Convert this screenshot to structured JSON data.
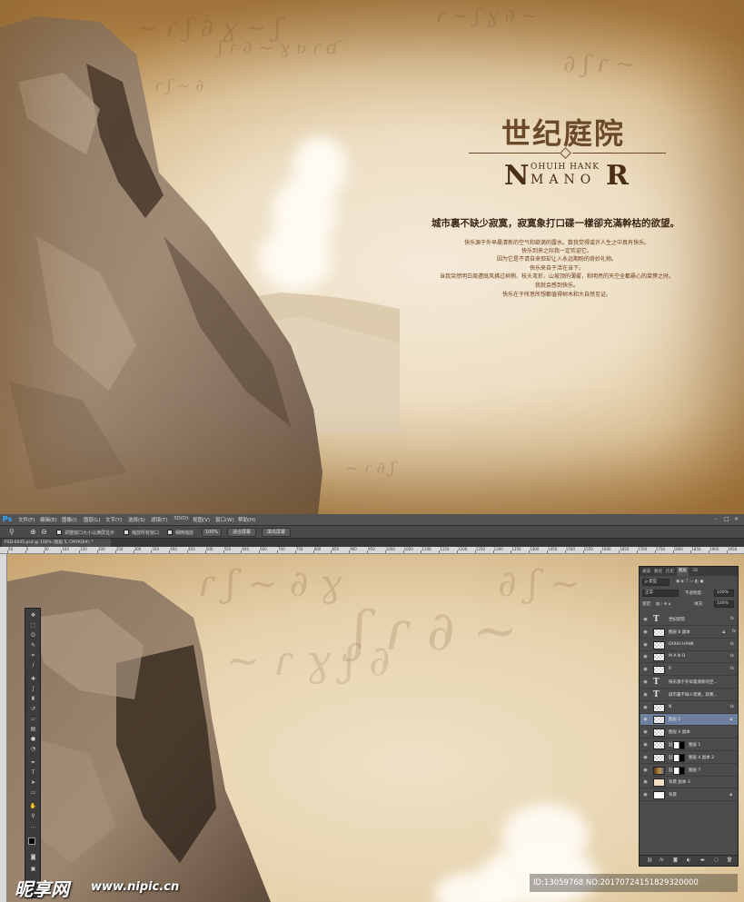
{
  "artwork": {
    "title_cn": "世纪庭院",
    "title_en_small": "OHUIH HANK",
    "title_en_left": "N",
    "title_en_mid": "MANO",
    "title_en_right": "R",
    "poem_title": "城市裏不缺少寂寞，寂寞象打口碟一樣卻充滿幹枯的欲望。",
    "poem_lines": [
      "快乐源于外早晨清新的空气和欲滴的露水。数我觉得或许人生之中真有快乐。",
      "快乐到来之际我一定欢迎它。",
      "因为它是不请自来但却让人永远期盼的奇妙礼物。",
      "快乐来自于活在当下。",
      "当我突然明白周遭既风拂过树梢、枝头弯折、山坡顶的薄雾，和明亮的天空全都悬心的菜悸之时。",
      "我就会感到快乐。",
      "快乐在于所思所想都值得树木和大自然见证。"
    ]
  },
  "ps": {
    "logo": "Ps",
    "menu": [
      "文件(F)",
      "编辑(E)",
      "图像(I)",
      "图层(L)",
      "文字(Y)",
      "选择(S)",
      "滤镜(T)",
      "3D(D)",
      "视图(V)",
      "窗口(W)",
      "帮助(H)"
    ],
    "window_controls": [
      "–",
      "□",
      "×"
    ],
    "options": {
      "resize_label": "调整窗口大小以满屏显示",
      "zoom_all_label": "缩放所有窗口",
      "scrubby_label": "细微缩放",
      "btn_100": "100%",
      "btn_fit": "适合屏幕",
      "btn_fill": "填充屏幕"
    },
    "doc_tab": "PSD-0045.psd @ 100% (图层 5, CMYK/8#) *",
    "ruler_numbers": [
      "50",
      "0",
      "50",
      "100",
      "150",
      "200",
      "250",
      "300",
      "350",
      "400",
      "450",
      "500",
      "550",
      "600",
      "650",
      "700",
      "750",
      "800",
      "850",
      "900",
      "950",
      "1000",
      "1050",
      "1100",
      "1150",
      "1200",
      "1250",
      "1300",
      "1350",
      "1400",
      "1450",
      "1500",
      "1550",
      "1600",
      "1650",
      "1700",
      "1750",
      "1800",
      "1850",
      "1900",
      "1950"
    ],
    "tool_icons": [
      "move-icon",
      "marquee-icon",
      "lasso-icon",
      "quick-select-icon",
      "crop-icon",
      "eyedropper-icon",
      "heal-icon",
      "brush-icon",
      "stamp-icon",
      "history-brush-icon",
      "eraser-icon",
      "gradient-icon",
      "blur-icon",
      "dodge-icon",
      "pen-icon",
      "type-icon",
      "path-select-icon",
      "shape-icon",
      "hand-icon",
      "zoom-icon"
    ],
    "colors": {
      "foreground": "#000000",
      "background": "#ffffff",
      "selected_layer": "#6e7fa0"
    },
    "layers_panel": {
      "tabs": [
        "通道",
        "路径",
        "历史",
        "图层",
        "3D"
      ],
      "active_tab": "图层",
      "filter_label": "ρ 类型",
      "mode_value": "正常",
      "opacity_label": "不透明度:",
      "opacity_value": "100%",
      "lock_label": "锁定:",
      "fill_label": "填充:",
      "fill_value": "100%",
      "layers": [
        {
          "name": "世纪庭院",
          "kind": "text",
          "fx": "fx"
        },
        {
          "name": "图层 8 副本",
          "kind": "pixel",
          "fx": "fx",
          "lock": true
        },
        {
          "name": "OHUH HANK",
          "kind": "pixel",
          "fx": "fx"
        },
        {
          "name": "M A N O",
          "kind": "pixel",
          "fx": "fx"
        },
        {
          "name": "R",
          "kind": "pixel",
          "fx": "fx"
        },
        {
          "name": "快乐源于外早晨清新的空...",
          "kind": "text"
        },
        {
          "name": "城市裏不缺少寂寞，寂寞...",
          "kind": "text"
        },
        {
          "name": "N",
          "kind": "pixel",
          "fx": "fx"
        },
        {
          "name": "图层 5",
          "kind": "pixel",
          "selected": true,
          "lock": true
        },
        {
          "name": "图层 4 副本",
          "kind": "pixel"
        },
        {
          "name": "图层 1",
          "kind": "pixel",
          "mask": true
        },
        {
          "name": "图层 4 副本 2",
          "kind": "pixel",
          "mask": true
        },
        {
          "name": "图层 7",
          "kind": "photo",
          "mask": true
        },
        {
          "name": "背景 副本 3",
          "kind": "cream"
        },
        {
          "name": "背景",
          "kind": "white",
          "lock": true
        }
      ],
      "footer_icons": [
        "link-icon",
        "fx-icon",
        "mask-icon",
        "adjustment-icon",
        "folder-icon",
        "new-layer-icon",
        "trash-icon"
      ]
    }
  },
  "watermark": {
    "logo": "昵享网",
    "url": "www.nipic.cn",
    "id": "ID:13059768 NO:20170724151829320000"
  }
}
